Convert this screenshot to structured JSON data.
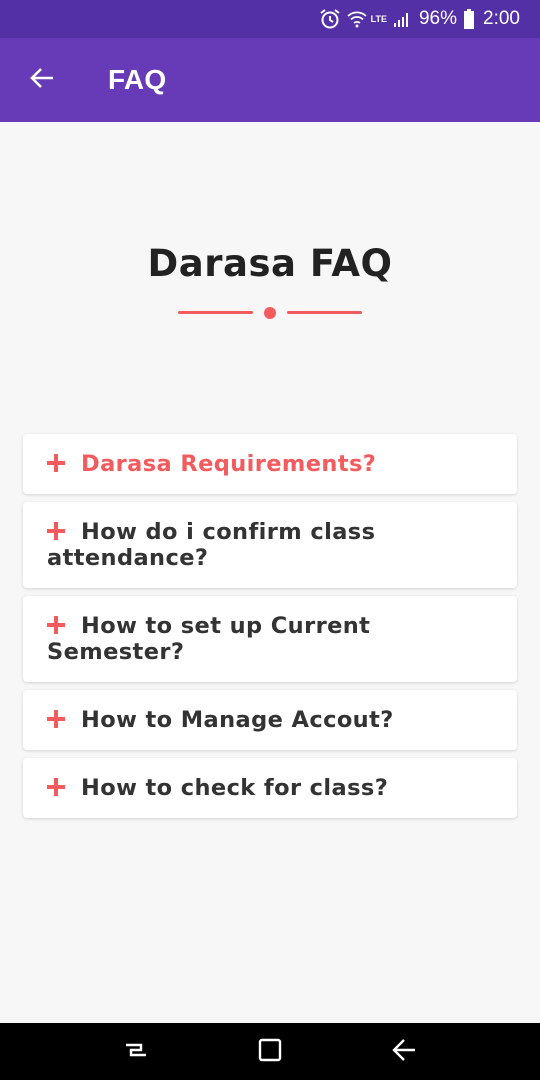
{
  "status_bar": {
    "icons": [
      "alarm-icon",
      "wifi-icon",
      "lte-signal-icon",
      "battery-icon"
    ],
    "network_label": "LTE",
    "battery_percent": "96%",
    "time": "2:00"
  },
  "app_bar": {
    "title": "FAQ",
    "back_icon": "arrow-left-icon"
  },
  "page": {
    "heading": "Darasa FAQ"
  },
  "faq": [
    {
      "question": "Darasa Requirements?",
      "expanded": false,
      "active": true
    },
    {
      "question": "How do i confirm class attendance?",
      "expanded": false,
      "active": false
    },
    {
      "question": "How to set up Current Semester?",
      "expanded": false,
      "active": false
    },
    {
      "question": "How to Manage Accout?",
      "expanded": false,
      "active": false
    },
    {
      "question": "How to check for class?",
      "expanded": false,
      "active": false
    }
  ],
  "nav_bar": {
    "buttons": [
      "recents-icon",
      "home-icon",
      "back-icon"
    ]
  },
  "colors": {
    "status_bar": "#5430a6",
    "app_bar": "#673ab7",
    "accent": "#f45b5e",
    "background": "#f7f7f7",
    "text": "#333333"
  }
}
